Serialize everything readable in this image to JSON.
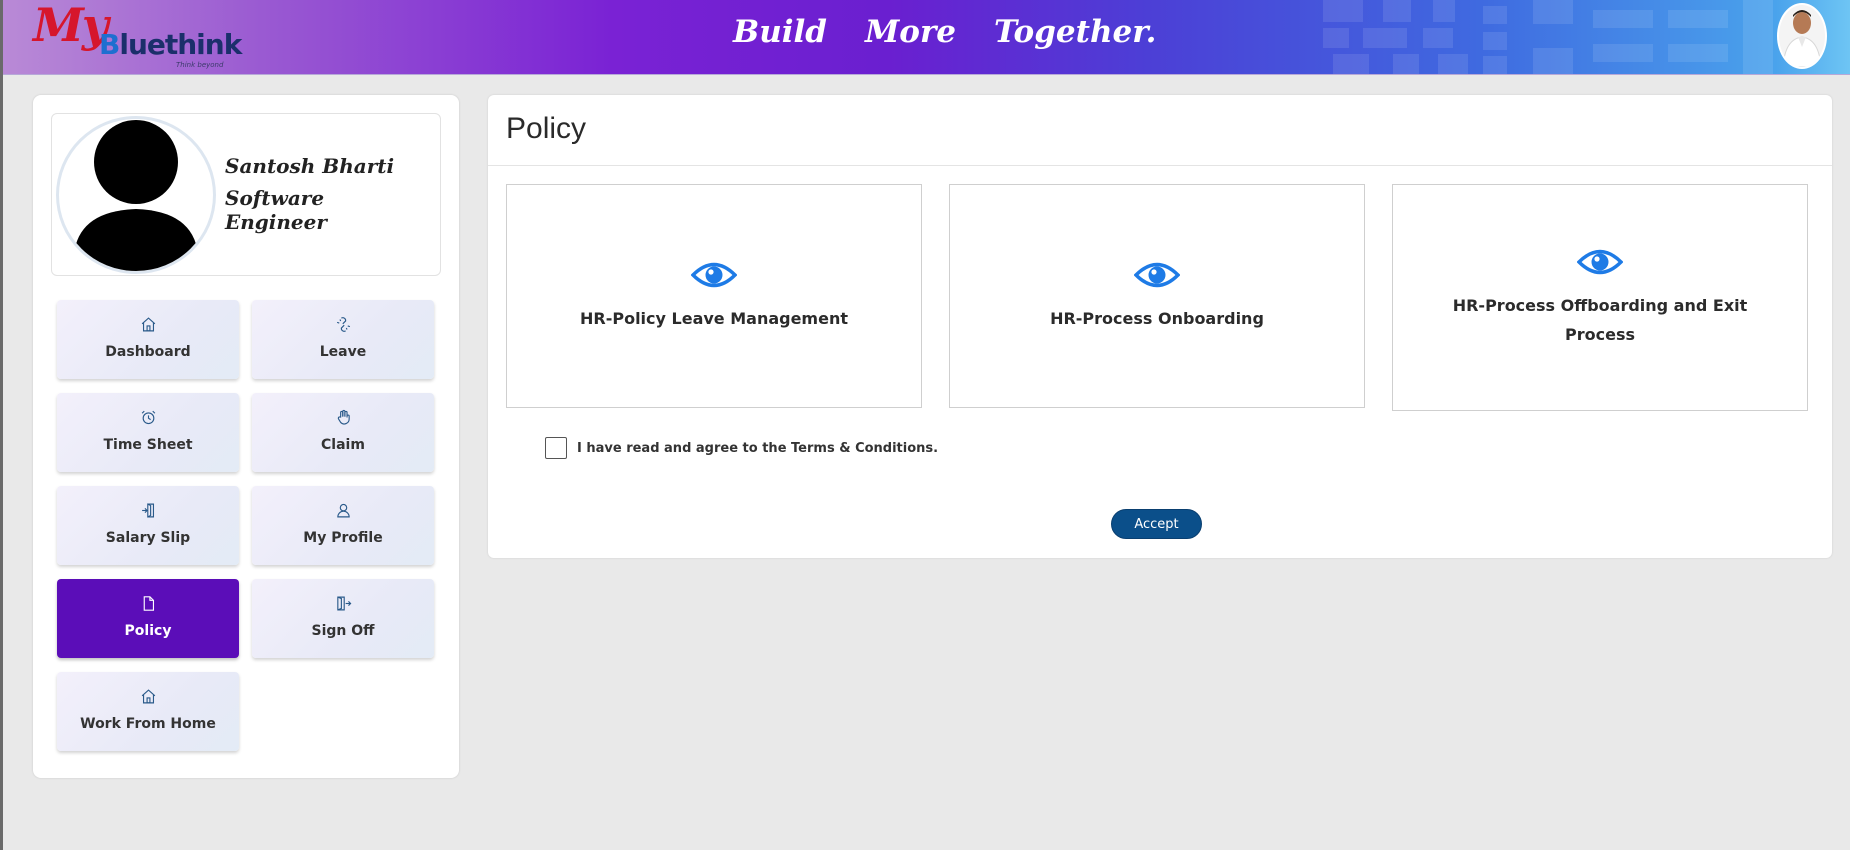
{
  "header": {
    "logo_my": "My",
    "logo_brand_first": "B",
    "logo_brand_rest": "luethink",
    "logo_tag": "Think beyond",
    "tagline": [
      "Build",
      "More",
      "Together."
    ]
  },
  "profile": {
    "name": "Santosh Bharti",
    "role": "Software Engineer"
  },
  "menu": {
    "items": [
      {
        "label": "Dashboard",
        "icon": "home-icon"
      },
      {
        "label": "Leave",
        "icon": "leave-icon"
      },
      {
        "label": "Time Sheet",
        "icon": "alarm-clock-icon"
      },
      {
        "label": "Claim",
        "icon": "hand-icon"
      },
      {
        "label": "Salary Slip",
        "icon": "salary-slip-icon"
      },
      {
        "label": "My Profile",
        "icon": "user-icon"
      },
      {
        "label": "Policy",
        "icon": "document-icon",
        "active": true
      },
      {
        "label": "Sign Off",
        "icon": "sign-off-icon"
      },
      {
        "label": "Work From Home",
        "icon": "home-icon"
      }
    ]
  },
  "main": {
    "title": "Policy",
    "cards": [
      {
        "title": "HR-Policy Leave Management",
        "icon": "eye-icon"
      },
      {
        "title": "HR-Process Onboarding",
        "icon": "eye-icon"
      },
      {
        "title": "HR-Process Offboarding and Exit Process",
        "icon": "eye-icon"
      }
    ],
    "agree_text": "I have read and agree to the Terms & Conditions.",
    "accept_label": "Accept"
  },
  "colors": {
    "accent": "#5b0db8",
    "eye": "#1e7be6",
    "button": "#0b4f8a"
  }
}
